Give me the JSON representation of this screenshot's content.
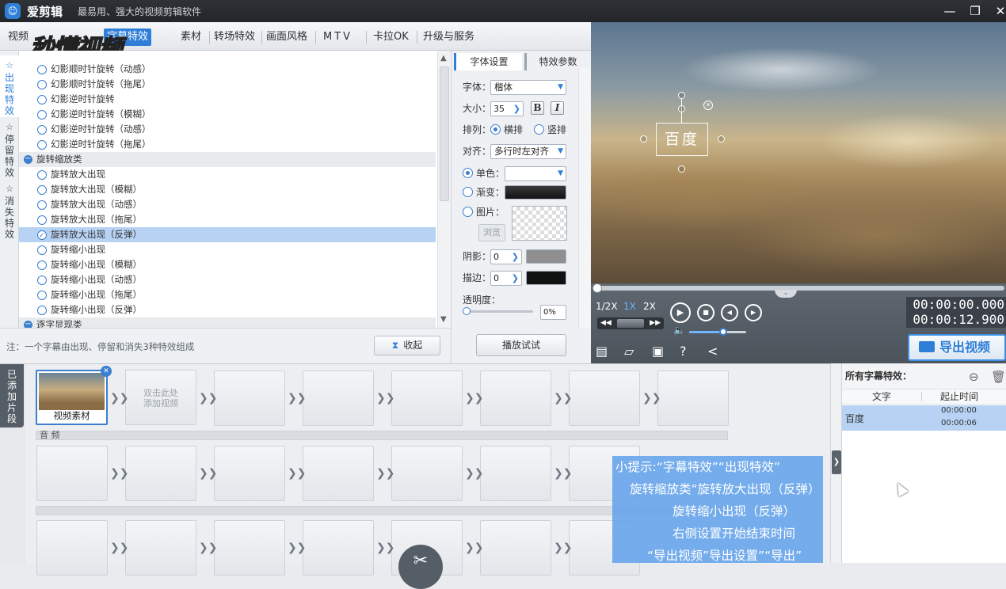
{
  "titlebar": {
    "app_name": "爱剪辑",
    "slogan": "最易用、强大的视频剪辑软件",
    "min": "—",
    "restore": "❐",
    "close": "✕"
  },
  "watermark": "秒懂视频",
  "menu": [
    "视频",
    "字幕特效",
    "素材",
    "转场特效",
    "画面风格",
    "MTV",
    "卡拉OK",
    "升级与服务"
  ],
  "menu_active": "字幕特效",
  "vertical_tabs": [
    {
      "label": "出现特效",
      "icon": "star-icon",
      "active": true
    },
    {
      "label": "停留特效",
      "icon": "star-icon",
      "active": false
    },
    {
      "label": "消失特效",
      "icon": "star-icon",
      "active": false
    }
  ],
  "effects": {
    "items_top": [
      "幻影顺时针旋转（动感）",
      "幻影顺时针旋转（拖尾）",
      "幻影逆时针旋转",
      "幻影逆时针旋转（模糊）",
      "幻影逆时针旋转（动感）",
      "幻影逆时针旋转（拖尾）"
    ],
    "group": "旋转缩放类",
    "items_group": [
      "旋转放大出现",
      "旋转放大出现（模糊）",
      "旋转放大出现（动感）",
      "旋转放大出现（拖尾）",
      "旋转放大出现（反弹）",
      "旋转缩小出现",
      "旋转缩小出现（模糊）",
      "旋转缩小出现（动感）",
      "旋转缩小出现（拖尾）",
      "旋转缩小出现（反弹）"
    ],
    "selected": "旋转放大出现（反弹）",
    "next_group": "逐字显现类"
  },
  "note": "注：一个字幕由出现、停留和消失3种特效组成",
  "collapse_label": "收起",
  "settings": {
    "tabs": [
      "字体设置",
      "特效参数"
    ],
    "font_label": "字体：",
    "font_value": "楷体",
    "size_label": "大小：",
    "size_value": "35",
    "bold": "B",
    "italic": "I",
    "arrange_label": "排列：",
    "arrange_h": "横排",
    "arrange_v": "竖排",
    "align_label": "对齐：",
    "align_value": "多行时左对齐",
    "solid_label": "单色：",
    "gradient_label": "渐变：",
    "image_label": "图片：",
    "browse_label": "浏览",
    "shadow_label": "阴影：",
    "shadow_value": "0",
    "stroke_label": "描边：",
    "stroke_value": "0",
    "opacity_label": "透明度：",
    "opacity_value": "0%",
    "preview_label": "播放试试",
    "colors": {
      "shadow": "#8f8f8f",
      "stroke": "#111111",
      "gradient": "#1a1a1a"
    }
  },
  "video": {
    "caption_text": "百度"
  },
  "player": {
    "speeds": [
      "1/2X",
      "1X",
      "2X"
    ],
    "speed_active": "1X",
    "time_current": "00:00:00.000",
    "time_total": "00:00:12.900",
    "volume": 0.6,
    "export_label": "导出视频"
  },
  "timeline": {
    "added_tab": "已添加片段",
    "clip_label": "视频素材",
    "add_hint_1": "双击此处",
    "add_hint_2": "添加视频",
    "audio_label": "音 频"
  },
  "tip": {
    "lines": [
      "小提示:“字幕特效”“出现特效”",
      "旋转缩放类“旋转放大出现（反弹）",
      "旋转缩小出现（反弹）",
      "右侧设置开始结束时间",
      "“导出视频”导出设置”“导出”"
    ]
  },
  "fx_panel": {
    "title": "所有字幕特效：",
    "col_text": "文字",
    "col_time": "起止时间",
    "rows": [
      {
        "text": "百度",
        "start": "00:00:00",
        "end": "00:00:06"
      }
    ]
  },
  "accent": "#2f7fd8"
}
